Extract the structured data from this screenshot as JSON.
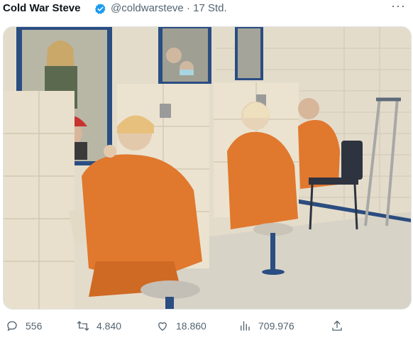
{
  "tweet": {
    "author_name": "Cold War Steve",
    "handle": "@coldwarsteve",
    "separator": "·",
    "time": "17 Std.",
    "more_icon": "more-icon",
    "verified_color": "#1d9bf0"
  },
  "actions": {
    "replies": "556",
    "retweets": "4.840",
    "likes": "18.860",
    "views": "709.976"
  },
  "media": {
    "alt": "Prison visiting booths collage"
  }
}
